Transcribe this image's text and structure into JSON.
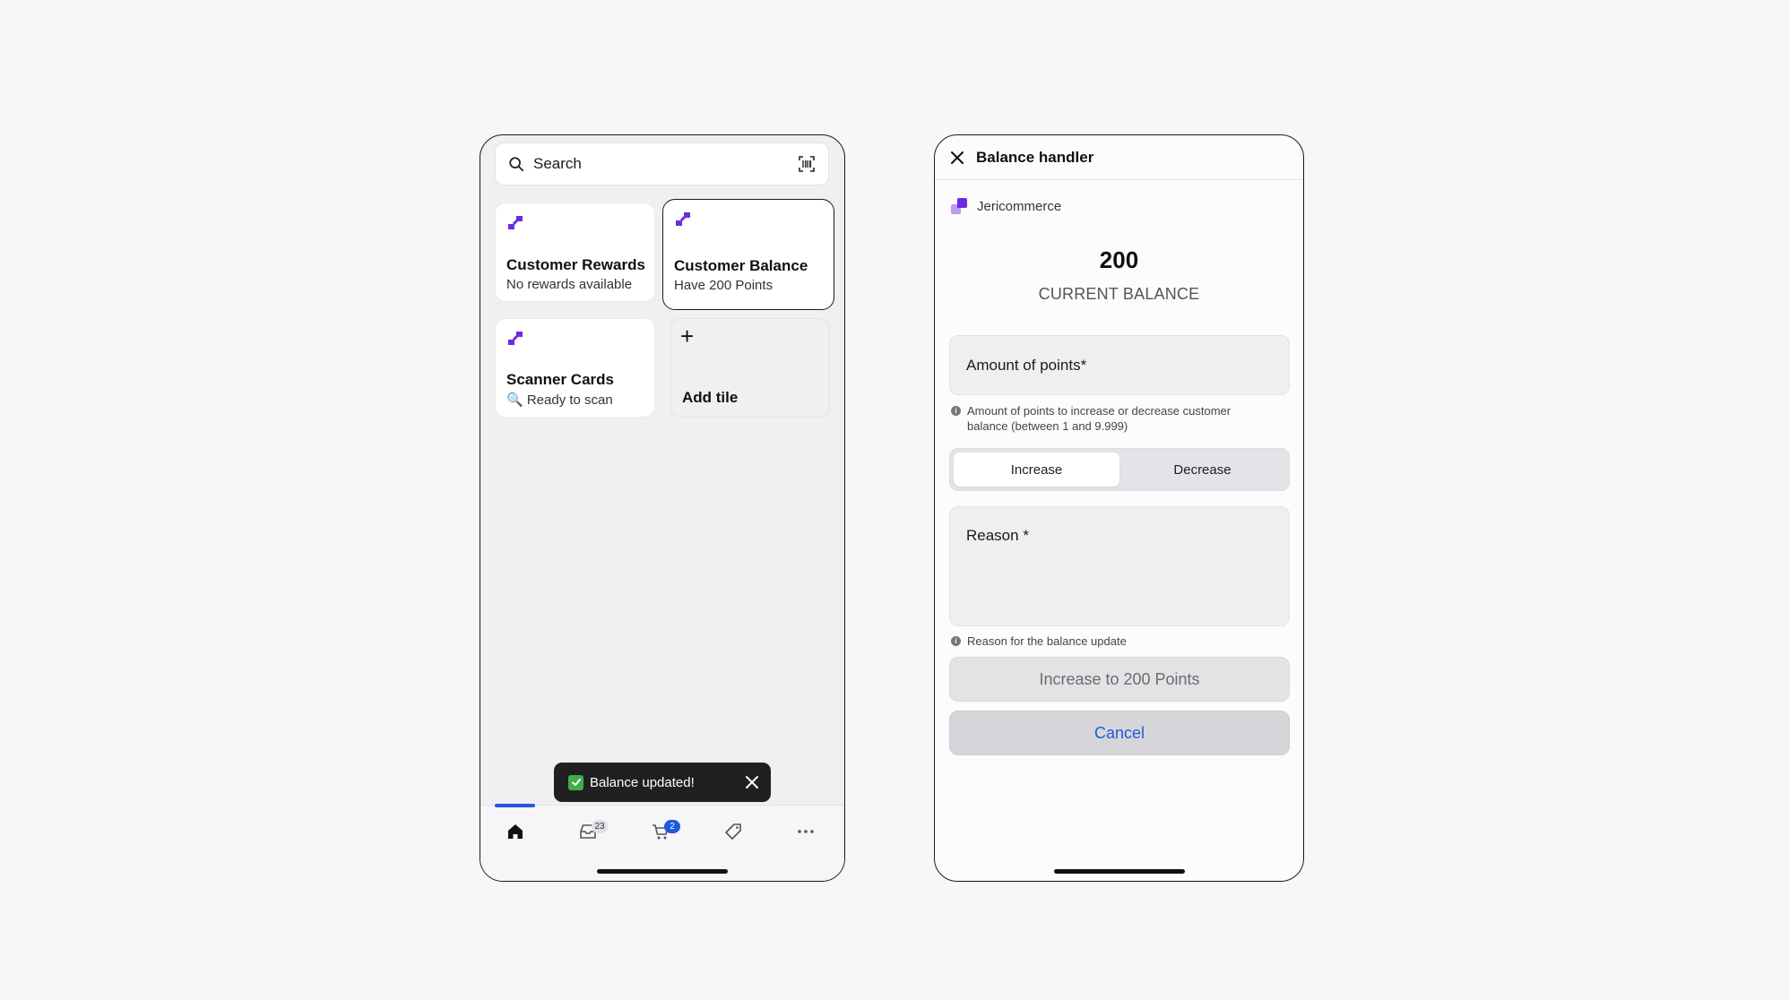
{
  "left_screen": {
    "search": {
      "placeholder": "Search",
      "icon": "search-icon",
      "scan_icon": "barcode-scan-icon"
    },
    "tiles": [
      {
        "title": "Customer Rewards",
        "subtitle": "No rewards available",
        "selected": false
      },
      {
        "title": "Customer Balance",
        "subtitle": "Have 200 Points",
        "selected": true
      },
      {
        "title": "Scanner Cards",
        "subtitle": "🔍 Ready to scan",
        "selected": false
      },
      {
        "title": "Add tile",
        "icon": "plus-icon"
      }
    ],
    "toast": {
      "text": "Balance updated!",
      "icon": "check-icon",
      "close_icon": "close-icon"
    },
    "bottom_nav": {
      "items": [
        {
          "name": "home",
          "icon": "home-icon",
          "active": true
        },
        {
          "name": "inbox",
          "icon": "inbox-icon",
          "badge": "23"
        },
        {
          "name": "cart",
          "icon": "cart-icon",
          "badge": "2"
        },
        {
          "name": "tags",
          "icon": "tag-icon"
        },
        {
          "name": "more",
          "icon": "more-icon"
        }
      ]
    },
    "accent_color": "#1f5ad8",
    "brand_color": "#6a2ce0"
  },
  "right_screen": {
    "header": {
      "title": "Balance handler",
      "close_icon": "close-icon"
    },
    "merchant": {
      "name": "Jericommerce",
      "icon": "jericommerce-logo"
    },
    "balance": {
      "value": "200",
      "label": "CURRENT BALANCE"
    },
    "amount_field": {
      "label": "Amount of points*",
      "value": "",
      "hint": "Amount of points to increase or decrease customer balance (between 1 and 9.999)"
    },
    "mode": {
      "options": [
        "Increase",
        "Decrease"
      ],
      "selected": "Increase"
    },
    "reason_field": {
      "label": "Reason *",
      "value": "",
      "hint": "Reason for the balance update"
    },
    "buttons": {
      "submit": "Increase to 200 Points",
      "cancel": "Cancel"
    }
  }
}
